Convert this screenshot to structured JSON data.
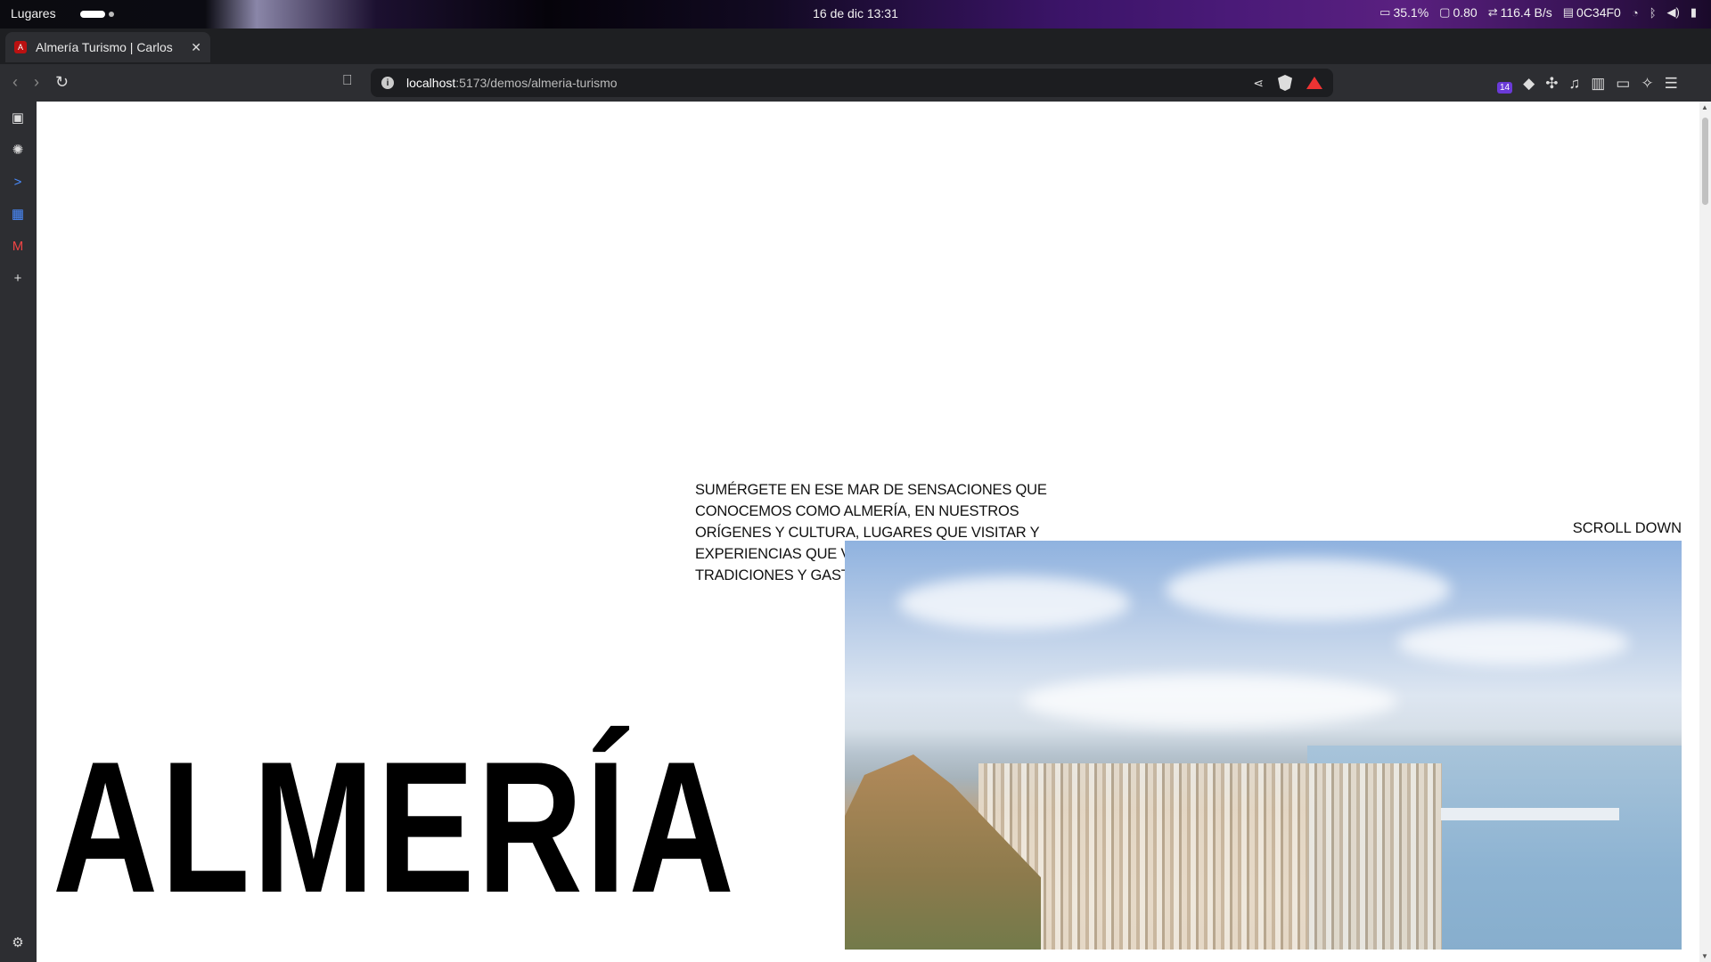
{
  "topbar": {
    "activities": "Lugares",
    "clock": "16 de dic  13:31",
    "cpu": "35.1%",
    "load": "0.80",
    "net": "116.4 B/s",
    "color_code": "0C34F0"
  },
  "browser": {
    "tab": {
      "title": "Almería Turismo | Carlos",
      "favicon_icon": "almeria-favicon"
    },
    "url": {
      "host": "localhost",
      "path": ":5173/demos/almeria-turismo"
    },
    "extensions_badge": "14"
  },
  "page": {
    "intro_text": "SUMÉRGETE EN ESE MAR DE SENSACIONES QUE CONOCEMOS COMO ALMERÍA, EN NUESTROS ORÍGENES Y CULTURA, LUGARES QUE VISITAR Y EXPERIENCIAS QUE VIVIR, NUESTRAS TRADICIONES Y GASTRONOMÍA.",
    "scroll_hint": "SCROLL DOWN",
    "title": "ALMERÍA",
    "hero_image": "Panoramic view of Almería city with the Alcazaba and port"
  },
  "colors": {
    "page_bg": "#ffffff",
    "text": "#111111",
    "chrome": "#2d2e32"
  }
}
